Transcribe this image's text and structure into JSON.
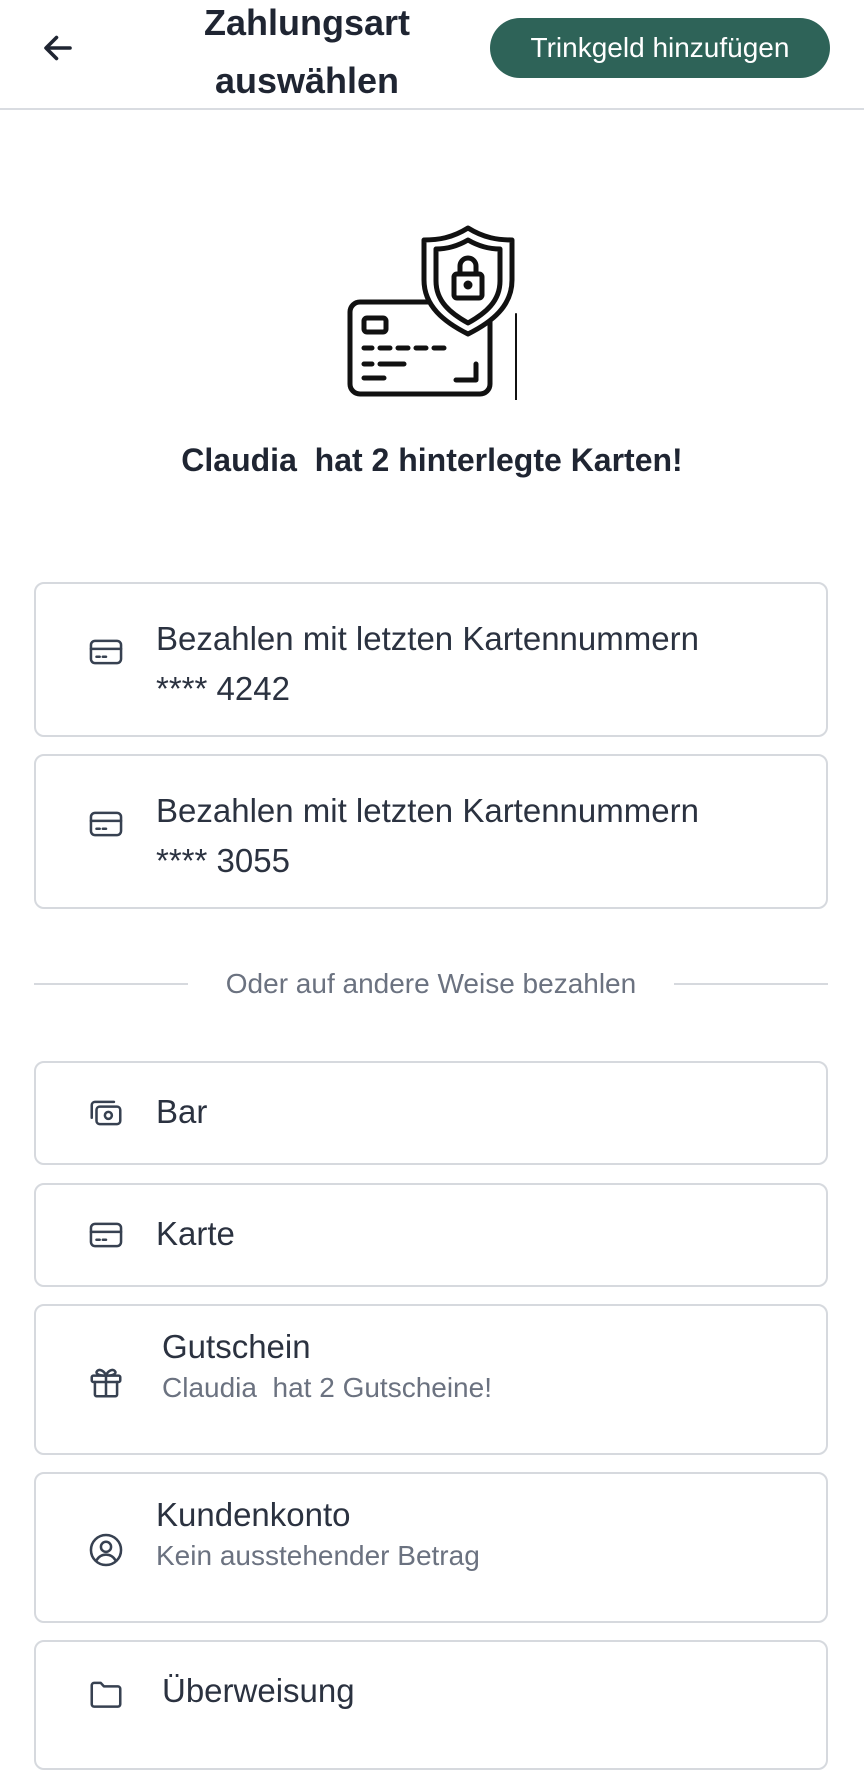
{
  "header": {
    "title_line1": "Zahlungsart",
    "title_line2": "auswählen",
    "tip_button": "Trinkgeld hinzufügen"
  },
  "summary": {
    "saved_cards_text": "Claudia  hat 2 hinterlegte Karten!"
  },
  "saved_cards": [
    {
      "line1": "Bezahlen mit letzten Kartennummern",
      "line2": "**** 4242",
      "icon": "credit-card-icon"
    },
    {
      "line1": "Bezahlen mit letzten Kartennummern",
      "line2": "**** 3055",
      "icon": "credit-card-icon"
    }
  ],
  "divider_text": "Oder auf andere Weise bezahlen",
  "methods": [
    {
      "label": "Bar",
      "icon": "cash-icon"
    },
    {
      "label": "Karte",
      "icon": "credit-card-icon"
    },
    {
      "label": "Gutschein",
      "sub": "Claudia  hat 2 Gutscheine!",
      "icon": "gift-icon"
    },
    {
      "label": "Kundenkonto",
      "sub": "Kein ausstehender Betrag",
      "icon": "user-circle-icon"
    },
    {
      "label": "Überweisung",
      "icon": "folder-icon"
    }
  ],
  "colors": {
    "accent": "#2e6358",
    "border": "#d6d9de",
    "text": "#1f2532",
    "muted": "#6b7280"
  }
}
